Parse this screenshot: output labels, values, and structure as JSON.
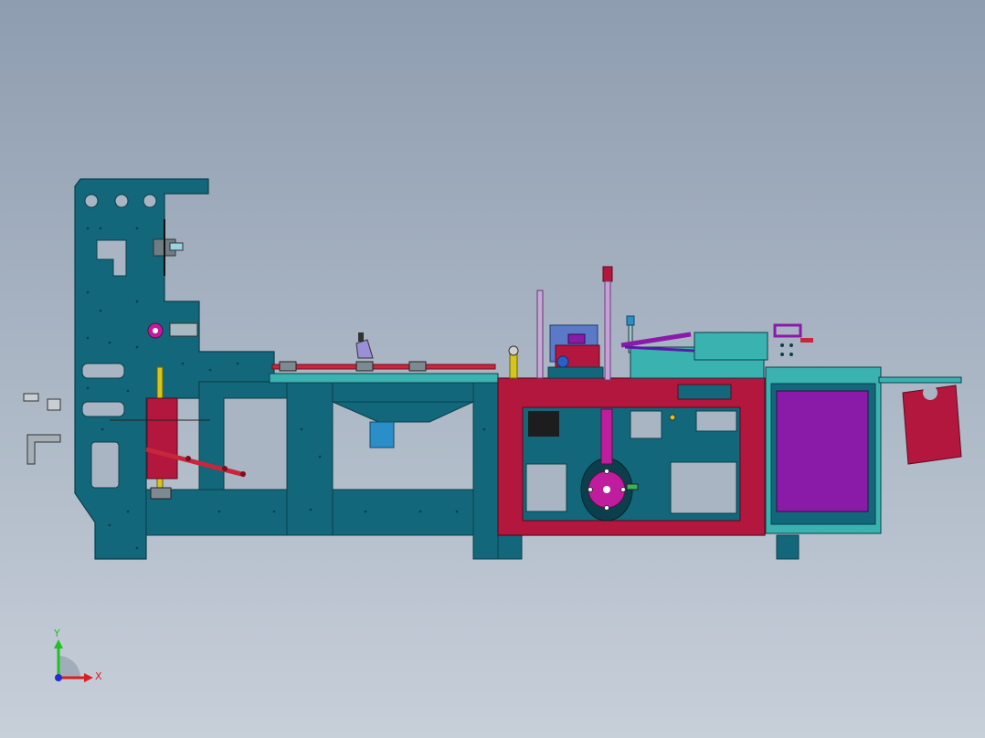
{
  "viewport": {
    "background_top": "#8e9db0",
    "background_bottom": "#c7cfd9"
  },
  "colors": {
    "frame_teal": "#12677a",
    "frame_edge": "#0b3f4c",
    "crimson": "#b3173e",
    "cyan_panel": "#3ab3b0",
    "purple": "#8a1aa8",
    "magenta": "#c01d9e",
    "red_rail": "#c8263a",
    "blue": "#2a8fc8",
    "yellow": "#d6c51e"
  },
  "triad": {
    "y_label": "Y",
    "x_label": "X",
    "y_color": "#1fc21f",
    "x_color": "#d92020",
    "z_color": "#2030d0",
    "icon": "coordinate-triad-icon"
  }
}
